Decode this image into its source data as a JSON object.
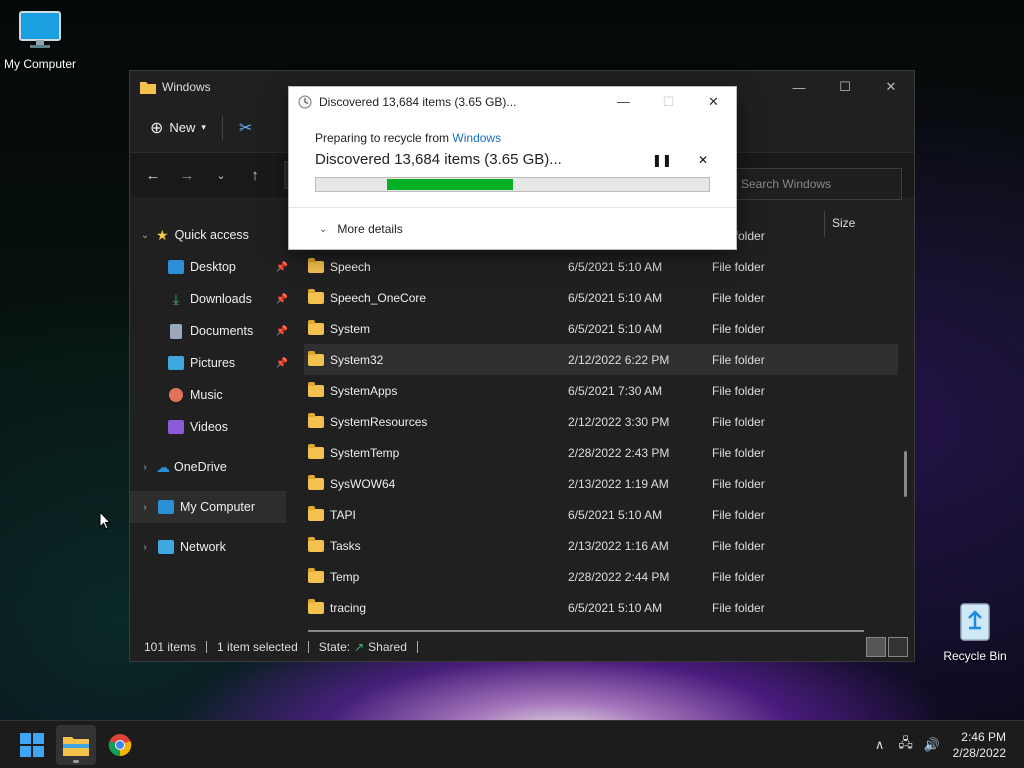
{
  "desktop": {
    "my_computer_label": "My Computer",
    "recycle_bin_label": "Recycle Bin"
  },
  "explorer": {
    "title": "Windows",
    "new_label": "New",
    "search_placeholder": "Search Windows",
    "column_size": "Size",
    "sidebar": {
      "quick_access": "Quick access",
      "desktop": "Desktop",
      "downloads": "Downloads",
      "documents": "Documents",
      "pictures": "Pictures",
      "music": "Music",
      "videos": "Videos",
      "onedrive": "OneDrive",
      "my_computer": "My Computer",
      "network": "Network"
    },
    "partial_row_type": "File folder",
    "files": [
      {
        "name": "Speech",
        "date": "6/5/2021 5:10 AM",
        "type": "File folder"
      },
      {
        "name": "Speech_OneCore",
        "date": "6/5/2021 5:10 AM",
        "type": "File folder"
      },
      {
        "name": "System",
        "date": "6/5/2021 5:10 AM",
        "type": "File folder"
      },
      {
        "name": "System32",
        "date": "2/12/2022 6:22 PM",
        "type": "File folder"
      },
      {
        "name": "SystemApps",
        "date": "6/5/2021 7:30 AM",
        "type": "File folder"
      },
      {
        "name": "SystemResources",
        "date": "2/12/2022 3:30 PM",
        "type": "File folder"
      },
      {
        "name": "SystemTemp",
        "date": "2/28/2022 2:43 PM",
        "type": "File folder"
      },
      {
        "name": "SysWOW64",
        "date": "2/13/2022 1:19 AM",
        "type": "File folder"
      },
      {
        "name": "TAPI",
        "date": "6/5/2021 5:10 AM",
        "type": "File folder"
      },
      {
        "name": "Tasks",
        "date": "2/13/2022 1:16 AM",
        "type": "File folder"
      },
      {
        "name": "Temp",
        "date": "2/28/2022 2:44 PM",
        "type": "File folder"
      },
      {
        "name": "tracing",
        "date": "6/5/2021 5:10 AM",
        "type": "File folder"
      }
    ],
    "status": {
      "items": "101 items",
      "selected": "1 item selected",
      "state_label": "State:",
      "state_value": "Shared"
    }
  },
  "dialog": {
    "title": "Discovered 13,684 items (3.65 GB)...",
    "preparing_prefix": "Preparing to recycle from",
    "preparing_link": "Windows",
    "heading": "Discovered 13,684 items (3.65 GB)...",
    "progress_start": 0.18,
    "progress_end": 0.5,
    "more_details": "More details"
  },
  "taskbar": {
    "time": "2:46 PM",
    "date": "2/28/2022"
  },
  "colors": {
    "progress_green": "#06b025",
    "folder_yellow": "#f2c14e",
    "link_blue": "#1e6fbf"
  }
}
